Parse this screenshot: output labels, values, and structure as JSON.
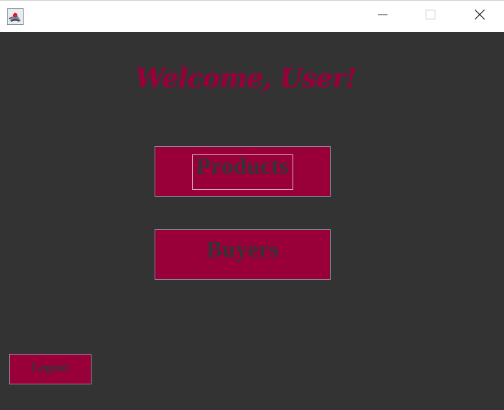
{
  "window": {
    "icon": "java-app-icon",
    "controls": {
      "minimize_icon": "minimize-icon",
      "maximize_icon": "maximize-icon",
      "close_icon": "close-icon"
    }
  },
  "main": {
    "welcome_text": "Welcome, User!",
    "products_label": "Products",
    "buyers_label": "Buyers",
    "logout_label": "Logout"
  },
  "colors": {
    "background": "#333333",
    "accent": "#99003a",
    "button_text": "#333333",
    "titlebar": "#ffffff"
  }
}
